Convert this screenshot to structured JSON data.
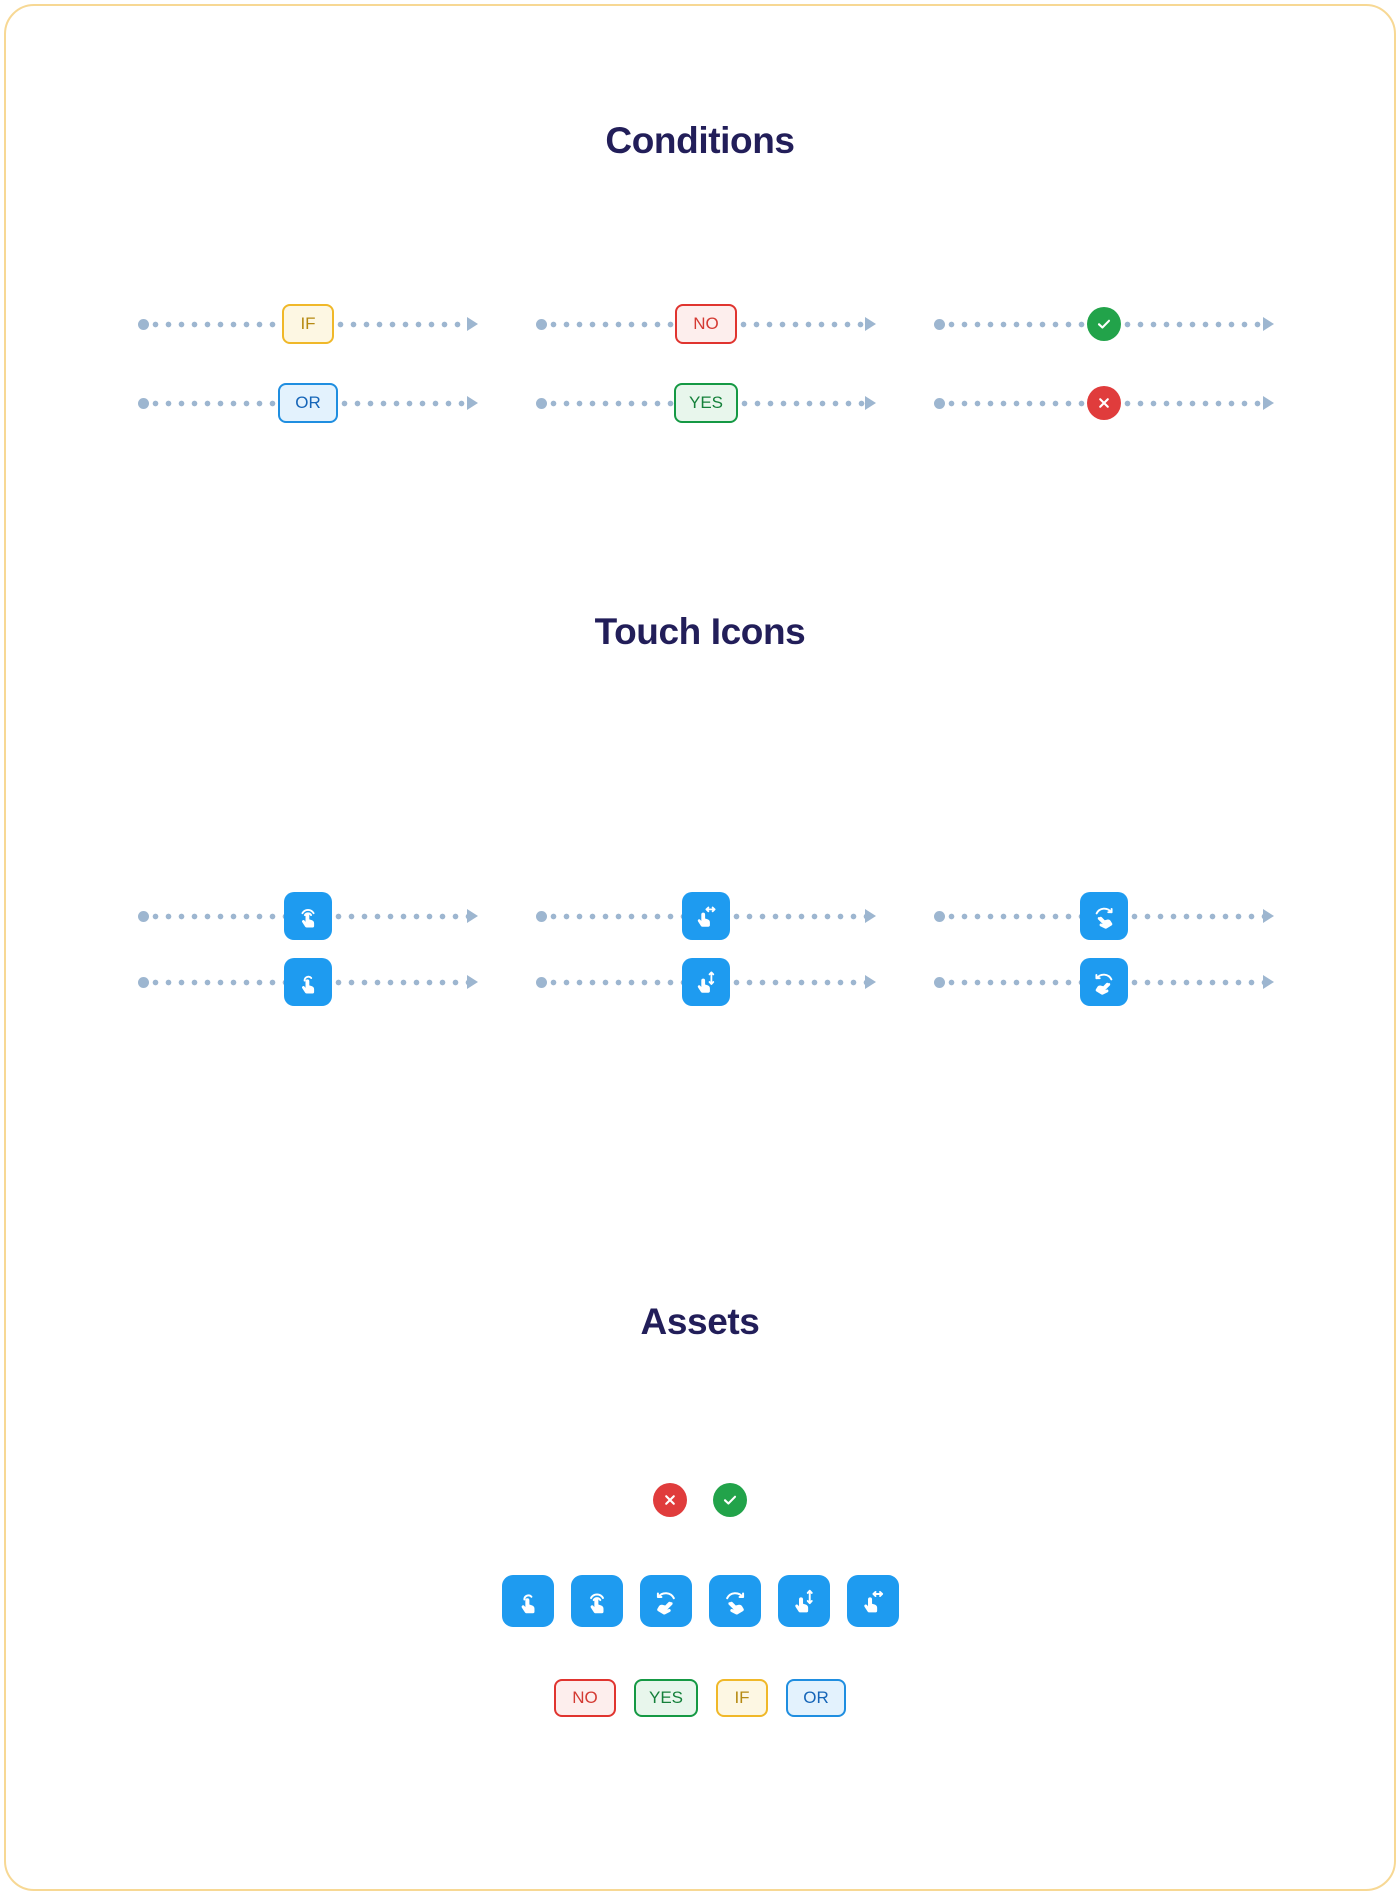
{
  "sections": [
    {
      "title": "Conditions"
    },
    {
      "title": "Touch Icons"
    },
    {
      "title": "Assets"
    }
  ],
  "conditions": {
    "title": "Conditions",
    "rows": [
      {
        "label": "IF",
        "kind": "badge-if",
        "icon": "if-badge"
      },
      {
        "label": "OR",
        "kind": "badge-or",
        "icon": "or-badge"
      },
      {
        "label": "NO",
        "kind": "badge-no",
        "icon": "no-badge"
      },
      {
        "label": "YES",
        "kind": "badge-yes",
        "icon": "yes-badge"
      },
      {
        "label": "",
        "kind": "circle-ok",
        "icon": "check-circle-icon"
      },
      {
        "label": "",
        "kind": "circle-bad",
        "icon": "close-circle-icon"
      }
    ]
  },
  "touch_icons": {
    "title": "Touch Icons",
    "rows": [
      {
        "icon": "tap-ripple-icon",
        "label": "tap with ripple"
      },
      {
        "icon": "tap-single-icon",
        "label": "single tap"
      },
      {
        "icon": "swipe-horizontal-icon",
        "label": "swipe horizontal"
      },
      {
        "icon": "swipe-vertical-icon",
        "label": "swipe vertical"
      },
      {
        "icon": "rotate-cw-icon",
        "label": "rotate clockwise"
      },
      {
        "icon": "rotate-ccw-icon",
        "label": "rotate counter-clockwise"
      }
    ]
  },
  "assets": {
    "title": "Assets",
    "circles": [
      {
        "icon": "close-circle-icon",
        "kind": "circle-bad",
        "color": "#e03c3c"
      },
      {
        "icon": "check-circle-icon",
        "kind": "circle-ok",
        "color": "#22a34a"
      }
    ],
    "tiles": [
      {
        "icon": "tap-single-icon"
      },
      {
        "icon": "tap-ripple-icon"
      },
      {
        "icon": "rotate-ccw-icon"
      },
      {
        "icon": "rotate-cw-icon"
      },
      {
        "icon": "swipe-vertical-icon"
      },
      {
        "icon": "swipe-horizontal-icon"
      }
    ],
    "badges": [
      {
        "label": "NO",
        "kind": "badge-no",
        "width": "w-no"
      },
      {
        "label": "YES",
        "kind": "badge-yes",
        "width": "w-yes"
      },
      {
        "label": "IF",
        "kind": "badge-if",
        "width": "w-if"
      },
      {
        "label": "OR",
        "kind": "badge-or",
        "width": "w-or"
      }
    ]
  },
  "colors": {
    "frame_border": "#f7d894",
    "heading": "#221e59",
    "connector": "#9db6d0",
    "tile_blue": "#1e9bf0",
    "if_border": "#f0b829",
    "if_fill": "#fdf7e3",
    "or_border": "#1f8ee0",
    "or_fill": "#e3f2fd",
    "no_border": "#e0342f",
    "no_fill": "#fdeeed",
    "yes_border": "#159944",
    "yes_fill": "#e8f6ec",
    "check_green": "#22a34a",
    "close_red": "#e03c3c"
  }
}
